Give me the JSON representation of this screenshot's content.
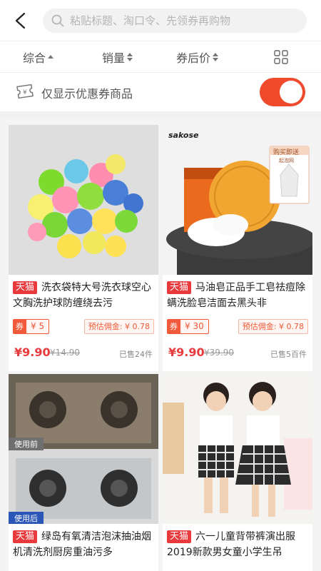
{
  "search": {
    "placeholder": "粘贴标题、淘口令、先领券再购物"
  },
  "sort": {
    "items": [
      {
        "label": "综合"
      },
      {
        "label": "销量"
      },
      {
        "label": "券后价"
      }
    ]
  },
  "coupon_filter": {
    "label": "仅显示优惠券商品",
    "enabled": true
  },
  "colors": {
    "accent": "#ef4a2c",
    "tmall_badge": "#e8393c",
    "price": "#e8393c"
  },
  "products": [
    {
      "badge": "天猫",
      "title": "洗衣袋特大号洗衣球空心文胸洗护球防缠绕去污",
      "coupon_prefix": "券",
      "coupon_value": "¥ 5",
      "commission": "预估佣金: ¥ 0.78",
      "price": "¥9.90",
      "old_price": "¥14.90",
      "sold": "已售24件"
    },
    {
      "badge": "天猫",
      "title": "马油皂正品手工皂祛痘除螨洗脸皂洁面去黑头非",
      "coupon_prefix": "券",
      "coupon_value": "¥ 30",
      "commission": "预估佣金: ¥ 0.78",
      "price": "¥9.90",
      "old_price": "¥39.90",
      "sold": "已售5百件",
      "image_brand": "sakose",
      "image_tag": "购买即送",
      "image_tag_sub": "起泡网"
    },
    {
      "badge": "天猫",
      "title": "绿岛有氧清洁泡沫抽油烟机清洗剂厨房重油污多",
      "image_tag_top": "使用前",
      "image_tag_bottom": "使用后"
    },
    {
      "badge": "天猫",
      "title": "六一儿童背带裤演出服2019新款男女童小学生吊"
    }
  ]
}
